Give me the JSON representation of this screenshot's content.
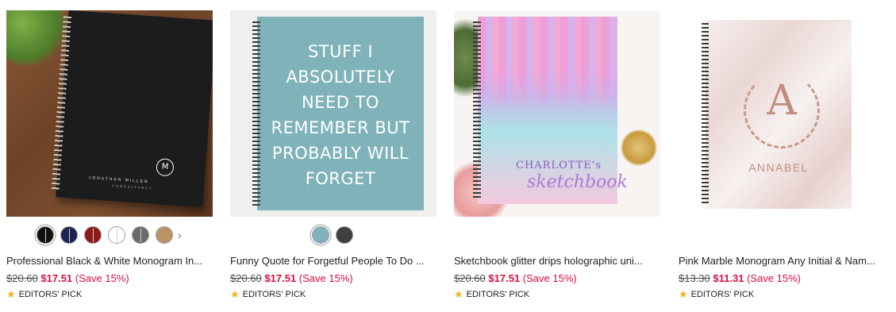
{
  "products": [
    {
      "title": "Professional Black & White Monogram In...",
      "old_price": "$20.60",
      "new_price": "$17.51",
      "save": "(Save 15%)",
      "badge": "EDITORS' PICK",
      "image": {
        "monogram": "M",
        "name": "JONATHAN MILLER",
        "subtitle": "CONSULTANCY"
      },
      "swatches": [
        "#111111",
        "#1c2454",
        "#8e1a1a",
        "#ffffff",
        "#6b6b6b",
        "#b89363"
      ],
      "more_icon": "chevron-right-icon"
    },
    {
      "title": "Funny Quote for Forgetful People To Do ...",
      "old_price": "$20.60",
      "new_price": "$17.51",
      "save": "(Save 15%)",
      "badge": "EDITORS' PICK",
      "image": {
        "quote_lines": [
          "STUFF I",
          "ABSOLUTELY",
          "NEED TO",
          "REMEMBER BUT",
          "PROBABLY WILL",
          "FORGET"
        ]
      },
      "swatches": [
        "#7fb3b9",
        "#3f3f3f"
      ]
    },
    {
      "title": "Sketchbook glitter drips holographic uni...",
      "old_price": "$20.60",
      "new_price": "$17.51",
      "save": "(Save 15%)",
      "badge": "EDITORS' PICK",
      "image": {
        "name": "CHARLOTTE's",
        "word": "sketchbook"
      }
    },
    {
      "title": "Pink Marble Monogram Any Initial & Nam...",
      "old_price": "$13.30",
      "new_price": "$11.31",
      "save": "(Save 15%)",
      "badge": "EDITORS' PICK",
      "image": {
        "initial": "A",
        "name": "ANNABEL"
      }
    }
  ],
  "colors": {
    "sale": "#d6103f",
    "star": "#f3b31a"
  },
  "icons": {
    "badge": "star-icon"
  }
}
